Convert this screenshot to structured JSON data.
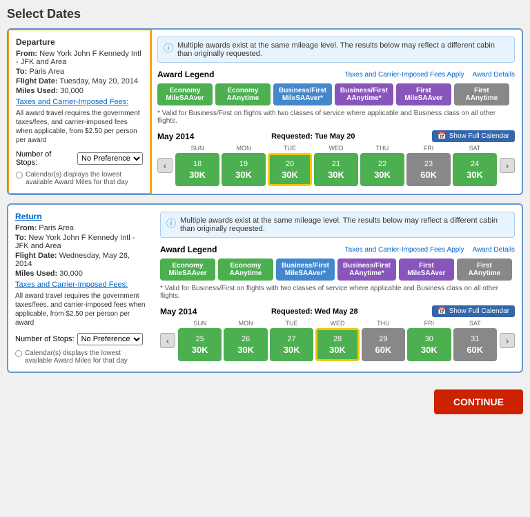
{
  "page": {
    "title": "Select Dates"
  },
  "departure": {
    "type_label": "Departure",
    "from_label": "From:",
    "from_value": "New York John F Kennedy Intl - JFK and Area",
    "to_label": "To:",
    "to_value": "Paris Area",
    "flight_date_label": "Flight Date:",
    "flight_date_value": "Tuesday, May 20, 2014",
    "miles_label": "Miles Used:",
    "miles_value": "30,000",
    "fees_label": "Taxes and Carrier-Imposed Fees:",
    "fees_text": "All award travel requires the government taxes/fees, and carrier-imposed fees when applicable, from $2.50 per person per award",
    "stops_label": "Number of Stops:",
    "stops_value": "No Preference",
    "calendar_note": "Calendar(s) displays the lowest available Award Miles for that day",
    "info_text": "Multiple awards exist at the same mileage level. The results below may reflect a different cabin than originally requested.",
    "legend_title": "Award Legend",
    "taxes_link": "Taxes and Carrier-Imposed Fees Apply",
    "award_details_link": "Award Details",
    "legend_items": [
      {
        "label": "Economy\nMileSAAver",
        "color": "green"
      },
      {
        "label": "Economy\nAAnytime",
        "color": "green"
      },
      {
        "label": "Business/First\nMileSAAver*",
        "color": "blue"
      },
      {
        "label": "Business/First\nAAnytime*",
        "color": "purple"
      },
      {
        "label": "First\nMileSAAver",
        "color": "purple"
      },
      {
        "label": "First\nAAnytime",
        "color": "gray"
      }
    ],
    "footnote": "* Valid for Business/First on flights with two classes of service where applicable and Business class on all other flights.",
    "cal_month": "May 2014",
    "cal_requested": "Requested: Tue May 20",
    "show_full_label": "Show Full Calendar",
    "days": [
      {
        "name": "SUN",
        "num": "18",
        "miles": "30K",
        "color": "green"
      },
      {
        "name": "MON",
        "num": "19",
        "miles": "30K",
        "color": "green"
      },
      {
        "name": "TUE",
        "num": "20",
        "miles": "30K",
        "color": "green-selected"
      },
      {
        "name": "WED",
        "num": "21",
        "miles": "30K",
        "color": "green"
      },
      {
        "name": "THU",
        "num": "22",
        "miles": "30K",
        "color": "green"
      },
      {
        "name": "FRI",
        "num": "23",
        "miles": "60K",
        "color": "gray-box"
      },
      {
        "name": "SAT",
        "num": "24",
        "miles": "30K",
        "color": "green"
      }
    ]
  },
  "return": {
    "type_label": "Return",
    "from_label": "From:",
    "from_value": "Paris Area",
    "to_label": "To:",
    "to_value": "New York John F Kennedy Intl - JFK and Area",
    "flight_date_label": "Flight Date:",
    "flight_date_value": "Wednesday, May 28, 2014",
    "miles_label": "Miles Used:",
    "miles_value": "30,000",
    "fees_label": "Taxes and Carrier-Imposed Fees:",
    "fees_text": "All award travel requires the government taxes/fees, and carrier-imposed fees when applicable, from $2.50 per person per award",
    "stops_label": "Number of Stops:",
    "stops_value": "No Preference",
    "calendar_note": "Calendar(s) displays the lowest available Award Miles for that day",
    "info_text": "Multiple awards exist at the same mileage level. The results below may reflect a different cabin than originally requested.",
    "legend_title": "Award Legend",
    "taxes_link": "Taxes and Carrier-Imposed Fees Apply",
    "award_details_link": "Award Details",
    "legend_items": [
      {
        "label": "Economy\nMileSAAver",
        "color": "green"
      },
      {
        "label": "Economy\nAAnytime",
        "color": "green"
      },
      {
        "label": "Business/First\nMileSAAver*",
        "color": "blue"
      },
      {
        "label": "Business/First\nAAnytime*",
        "color": "purple"
      },
      {
        "label": "First\nMileSAAver",
        "color": "purple"
      },
      {
        "label": "First\nAAnytime",
        "color": "gray"
      }
    ],
    "footnote": "* Valid for Business/First on flights with two classes of service where applicable and Business class on all other flights.",
    "cal_month": "May 2014",
    "cal_requested": "Requested: Wed May 28",
    "show_full_label": "Show Full Calendar",
    "days": [
      {
        "name": "SUN",
        "num": "25",
        "miles": "30K",
        "color": "green"
      },
      {
        "name": "MON",
        "num": "26",
        "miles": "30K",
        "color": "green"
      },
      {
        "name": "TUE",
        "num": "27",
        "miles": "30K",
        "color": "green"
      },
      {
        "name": "WED",
        "num": "28",
        "miles": "30K",
        "color": "green-selected"
      },
      {
        "name": "THU",
        "num": "29",
        "miles": "60K",
        "color": "gray-box"
      },
      {
        "name": "FRI",
        "num": "30",
        "miles": "30K",
        "color": "green"
      },
      {
        "name": "SAT",
        "num": "31",
        "miles": "60K",
        "color": "gray-box"
      }
    ]
  },
  "footer": {
    "continue_label": "CONTINUE"
  }
}
